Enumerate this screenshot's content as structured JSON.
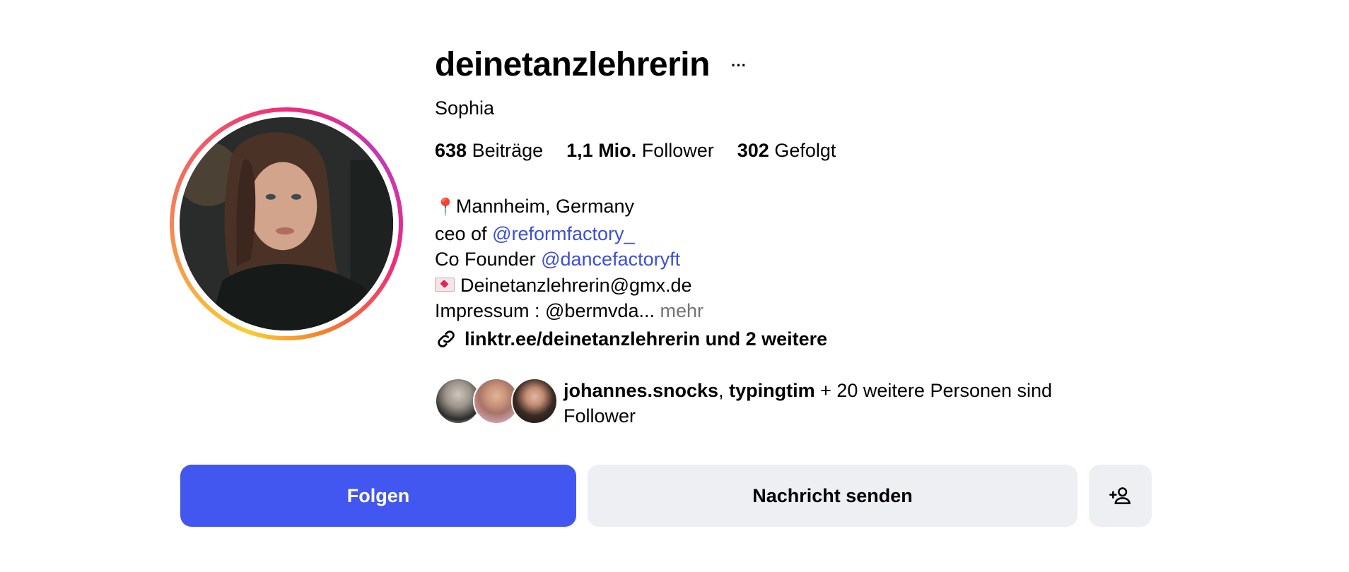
{
  "profile": {
    "username": "deinetanzlehrerin",
    "more_icon": "···",
    "full_name": "Sophia"
  },
  "stats": {
    "posts_count": "638",
    "posts_label": "Beiträge",
    "followers_count": "1,1 Mio.",
    "followers_label": "Follower",
    "following_count": "302",
    "following_label": "Gefolgt"
  },
  "bio": {
    "location_icon": "📍",
    "location": "Mannheim, Germany",
    "ceo_prefix": "ceo of ",
    "ceo_mention": "@reformfactory_",
    "cofounder_prefix": "Co Founder ",
    "cofounder_mention": "@dancefactoryft",
    "email": "Deinetanzlehrerin@gmx.de",
    "impressum": "Impressum : @bermvda...",
    "more": "mehr"
  },
  "link": {
    "icon": "link-icon",
    "text": "linktr.ee/deinetanzlehrerin und 2 weitere"
  },
  "followed_by": {
    "user1": "johannes.snocks",
    "separator": ", ",
    "user2": "typingtim",
    "rest": " + 20 weitere Personen sind Follower"
  },
  "actions": {
    "follow": "Folgen",
    "message": "Nachricht senden",
    "add_icon": "person-add-icon"
  },
  "colors": {
    "primary_button": "#4257ef",
    "secondary_button": "#eeeff2",
    "mention": "#3b4fd8",
    "muted": "#737373"
  }
}
